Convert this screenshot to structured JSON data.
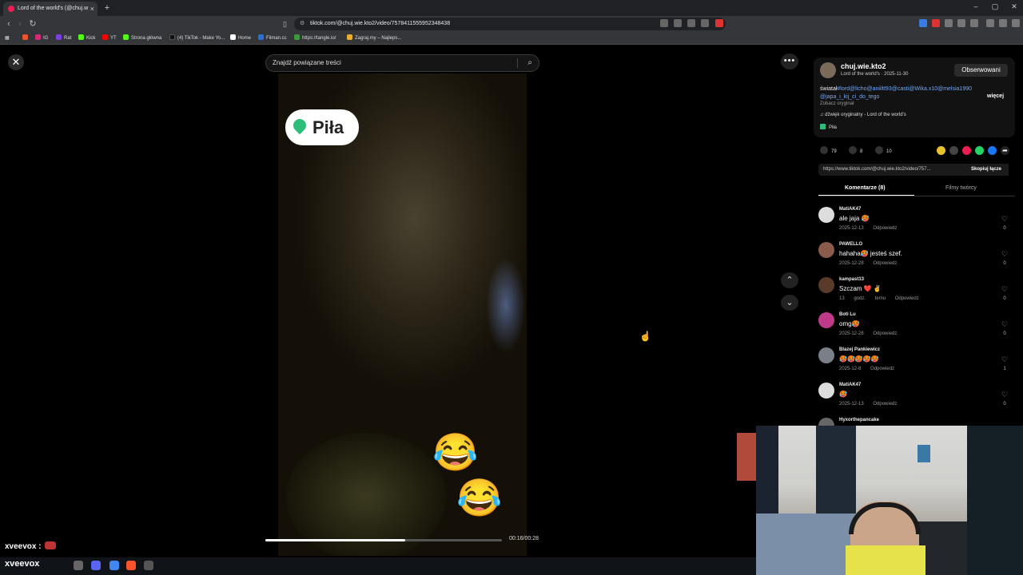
{
  "browser": {
    "tab_title": "Lord of the world's (@chuj.w",
    "tab_close": "×",
    "new_tab": "+",
    "url": "tiktok.com/@chuj.wie.kto2/video/7578411555952348438",
    "window_controls": [
      "–",
      "▢",
      "✕"
    ],
    "bookmarks": [
      {
        "label": "",
        "color": "#e8552b"
      },
      {
        "label": "IG",
        "color": "#d62976"
      },
      {
        "label": "Rat",
        "color": "#7b3fe4"
      },
      {
        "label": "Kick",
        "color": "#53fc18"
      },
      {
        "label": "YT",
        "color": "#ff0000"
      },
      {
        "label": "Strona główna",
        "color": "#53fc18"
      },
      {
        "label": "(4) TikTok - Make Yo...",
        "color": "#111111"
      },
      {
        "label": "Home",
        "color": "#ffffff"
      },
      {
        "label": "Filman.cc",
        "color": "#2a6fd6"
      },
      {
        "label": "https://tangle.io/",
        "color": "#3a9a3a"
      },
      {
        "label": "Zagraj.my – Najleps...",
        "color": "#e8b02b"
      }
    ]
  },
  "page": {
    "search_placeholder": "Znajdź powiązane treści",
    "sticker_label": "Piła",
    "video_time": "00:16/00:28",
    "progress_fraction": 0.59,
    "emoji": "😂"
  },
  "panel": {
    "author_name": "chuj.wie.kto2",
    "author_sub": "Lord of the world's · 2025-11-30",
    "follow_label": "Obserwowani",
    "desc_lead": "światał",
    "desc_tags": "#lord@licho@aniiltt93@casti@Wika.x10@melsia1990 @japa_i_kij_ci_do_tego",
    "more_label": "więcej",
    "see_translation": "Zobacz oryginał",
    "sound": "♫ dźwięk oryginalny - Lord of the world's",
    "place": "Piła",
    "likes": "79",
    "comments": "8",
    "saves": "10",
    "link": "https://www.tiktok.com/@chuj.wie.kto2/video/757...",
    "copy_label": "Skopiuj łącze",
    "tab_comments": "Komentarze (8)",
    "tab_creator": "Filmy twórcy"
  },
  "comments": [
    {
      "user": "MatiAK47",
      "text": "ale jaja 🥵",
      "date": "2025-12-13",
      "reply": "Odpowiedz",
      "likes": "0",
      "avatar_color": "#dddddd"
    },
    {
      "user": "PAWELLO",
      "text": "hahaha🥵 jesteś szef.",
      "date": "2025-12-28",
      "reply": "Odpowiedz",
      "likes": "0",
      "avatar_color": "#8a5a4a"
    },
    {
      "user": "kampast13",
      "text": "Szczam ❤️ ✌️",
      "date": "13 godz. temu",
      "reply": "Odpowiedz",
      "likes": "0",
      "avatar_color": "#5a3a2a"
    },
    {
      "user": "Boti Lu",
      "text": "omg🥵",
      "date": "2025-12-28",
      "reply": "Odpowiedz",
      "likes": "0",
      "avatar_color": "#c03a8a"
    },
    {
      "user": "Blazej Pankiewicz",
      "text": "🥵🥵🥵🥵🥵",
      "date": "2025-12-8",
      "reply": "Odpowiedz",
      "likes": "1",
      "avatar_color": "#7a8088"
    },
    {
      "user": "MatiAK47",
      "text": "🥵",
      "date": "2025-12-13",
      "reply": "Odpowiedz",
      "likes": "0",
      "avatar_color": "#dddddd"
    },
    {
      "user": "Hyxorthepancake",
      "text": "",
      "date": "",
      "reply": "",
      "likes": "",
      "avatar_color": "#666666"
    }
  ],
  "overlay": {
    "chat_name": "xveevox :",
    "taskbar_name": "xveevox"
  }
}
